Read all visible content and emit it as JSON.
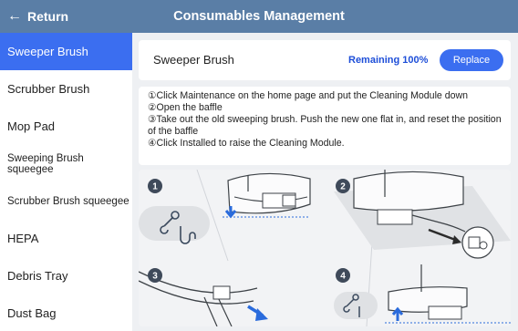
{
  "header": {
    "back_icon": "arrow-left",
    "back_label": "Return",
    "title": "Consumables Management",
    "color": "#5a7ea6"
  },
  "sidebar": {
    "items": [
      {
        "label": "Sweeper Brush",
        "active": true
      },
      {
        "label": "Scrubber Brush"
      },
      {
        "label": "Mop Pad"
      },
      {
        "label": "Sweeping Brush squeegee"
      },
      {
        "label": "Scrubber Brush squeegee"
      },
      {
        "label": "HEPA"
      },
      {
        "label": "Debris Tray"
      },
      {
        "label": "Dust Bag"
      }
    ]
  },
  "consumable": {
    "name": "Sweeper Brush",
    "remaining": "Remaining 100%",
    "replace_label": "Replace"
  },
  "instructions": {
    "steps": [
      "①Click Maintenance on the home page and put the Cleaning Module down",
      "②Open the baffle",
      "③Take out the old sweeping brush. Push the new one flat in, and reset the position of the baffle",
      "④Click Installed to raise the Cleaning Module."
    ]
  },
  "illustration": {
    "badges": [
      "1",
      "2",
      "3",
      "4"
    ],
    "icons": [
      "wrench-tap-icon",
      "arrow-down-icon",
      "arrow-up-icon",
      "brush-detail-icon"
    ]
  },
  "colors": {
    "accent": "#3b6ef0",
    "remaining": "#1d4ed8",
    "badge": "#3f4a5a"
  }
}
